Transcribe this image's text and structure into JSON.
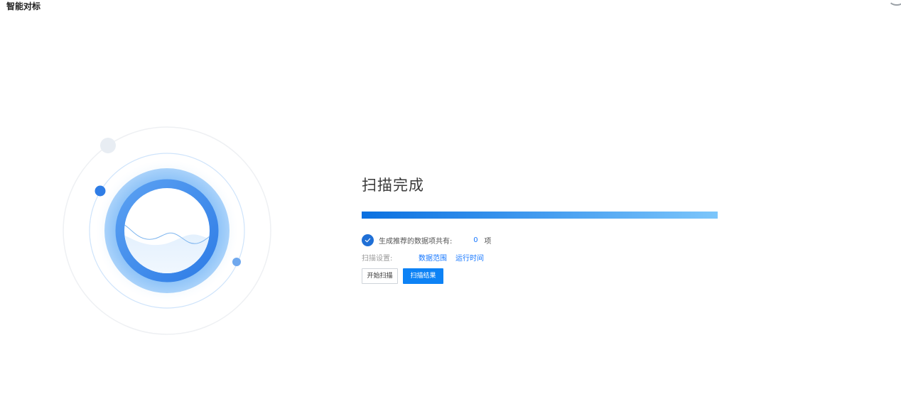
{
  "header": {
    "title": "智能对标"
  },
  "result": {
    "title": "扫描完成",
    "progress_percent": 100,
    "summary": {
      "label": "生成推荐的数据项共有:",
      "count": "0",
      "unit": "项"
    },
    "settings": {
      "label": "扫描设置:",
      "links": [
        "数据范围",
        "运行时间"
      ]
    },
    "buttons": {
      "start_scan": "开始扫描",
      "scan_results": "扫描结果"
    }
  },
  "icons": {
    "check": "check-icon",
    "illustration": "scan-radar-illustration"
  },
  "colors": {
    "accent": "#1677ff",
    "primary_button": "#0d82f5",
    "progress_start": "#0a70e0",
    "progress_end": "#7cc6fb"
  }
}
